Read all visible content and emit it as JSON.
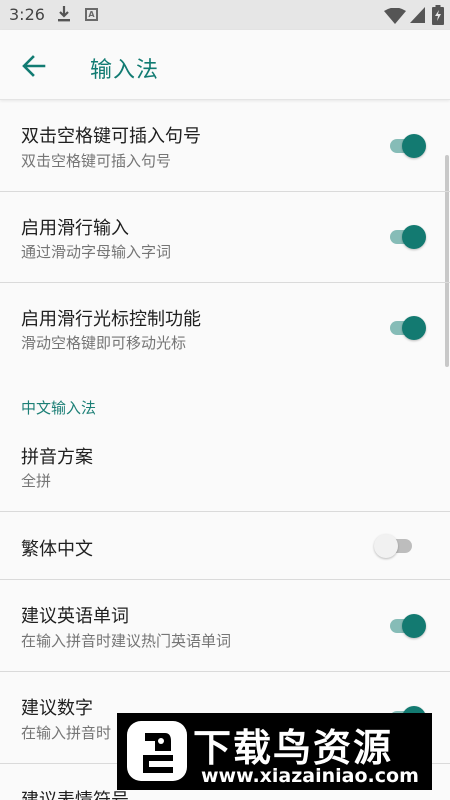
{
  "status_bar": {
    "time": "3:26",
    "icons": [
      "download-icon",
      "a-notification-icon",
      "wifi-icon",
      "signal-icon",
      "battery-icon"
    ]
  },
  "app_bar": {
    "back_icon": "arrow-left-icon",
    "title": "输入法"
  },
  "settings": [
    {
      "title": "双击空格键可插入句号",
      "subtitle": "双击空格键可插入句号",
      "enabled": true
    },
    {
      "title": "启用滑行输入",
      "subtitle": "通过滑动字母输入字词",
      "enabled": true
    },
    {
      "title": "启用滑行光标控制功能",
      "subtitle": "滑动空格键即可移动光标",
      "enabled": true
    }
  ],
  "chinese_section": {
    "header": "中文输入法",
    "pinyin_scheme": {
      "title": "拼音方案",
      "value": "全拼"
    },
    "traditional": {
      "title": "繁体中文",
      "enabled": false
    },
    "suggest_english": {
      "title": "建议英语单词",
      "subtitle": "在输入拼音时建议热门英语单词",
      "enabled": true
    },
    "suggest_numbers": {
      "title": "建议数字",
      "subtitle": "在输入拼音时",
      "enabled": true
    },
    "suggest_emoji": {
      "title": "建议表情符号"
    }
  },
  "watermark": {
    "title": "下载鸟资源",
    "url": "www.xiazainiao.com"
  },
  "colors": {
    "accent": "#117b72",
    "toggle_on_thumb": "#137a71",
    "toggle_on_track": "#86bcb7",
    "toggle_off_track": "#bdbdbd",
    "background": "#fafafa",
    "status_bar": "#e6e6e6"
  }
}
